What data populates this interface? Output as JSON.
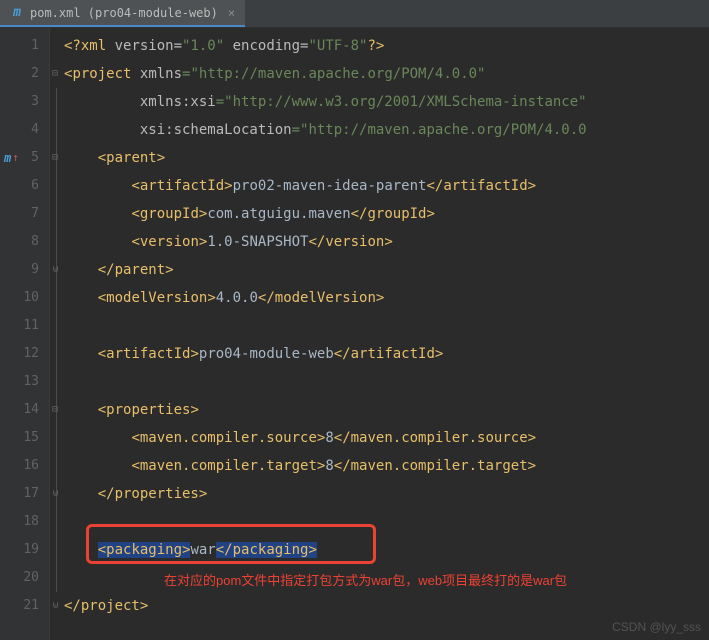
{
  "tab": {
    "icon": "m",
    "title": "pom.xml (pro04-module-web)",
    "close": "×"
  },
  "lines": {
    "count": 21,
    "markerLine": 5
  },
  "code": {
    "l1": {
      "pi_open": "<?",
      "pi_name": "xml",
      "attrs": " version=",
      "v1": "\"1.0\"",
      "attrs2": " encoding=",
      "v2": "\"UTF-8\"",
      "pi_close": "?>"
    },
    "l2": {
      "open": "<",
      "tag": "project",
      "sp": " ",
      "attr": "xmlns",
      "eq": "=",
      "val": "\"http://maven.apache.org/POM/4.0.0\""
    },
    "l3": {
      "attr": "xmlns:xsi",
      "eq": "=",
      "val": "\"http://www.w3.org/2001/XMLSchema-instance\""
    },
    "l4": {
      "attr": "xsi:schemaLocation",
      "eq": "=",
      "val": "\"http://maven.apache.org/POM/4.0.0 "
    },
    "l5": {
      "open": "<",
      "tag": "parent",
      "close": ">"
    },
    "l6": {
      "open": "<",
      "tag": "artifactId",
      "gt": ">",
      "txt": "pro02-maven-idea-parent",
      "ct": "</",
      "ctag": "artifactId",
      "cgt": ">"
    },
    "l7": {
      "open": "<",
      "tag": "groupId",
      "gt": ">",
      "txt": "com.atguigu.maven",
      "ct": "</",
      "ctag": "groupId",
      "cgt": ">"
    },
    "l8": {
      "open": "<",
      "tag": "version",
      "gt": ">",
      "txt": "1.0-SNAPSHOT",
      "ct": "</",
      "ctag": "version",
      "cgt": ">"
    },
    "l9": {
      "ct": "</",
      "tag": "parent",
      "gt": ">"
    },
    "l10": {
      "open": "<",
      "tag": "modelVersion",
      "gt": ">",
      "txt": "4.0.0",
      "ct": "</",
      "ctag": "modelVersion",
      "cgt": ">"
    },
    "l12": {
      "open": "<",
      "tag": "artifactId",
      "gt": ">",
      "txt": "pro04-module-web",
      "ct": "</",
      "ctag": "artifactId",
      "cgt": ">"
    },
    "l14": {
      "open": "<",
      "tag": "properties",
      "gt": ">"
    },
    "l15": {
      "open": "<",
      "tag": "maven.compiler.source",
      "gt": ">",
      "txt": "8",
      "ct": "</",
      "ctag": "maven.compiler.source",
      "cgt": ">"
    },
    "l16": {
      "open": "<",
      "tag": "maven.compiler.target",
      "gt": ">",
      "txt": "8",
      "ct": "</",
      "ctag": "maven.compiler.target",
      "cgt": ">"
    },
    "l17": {
      "ct": "</",
      "tag": "properties",
      "gt": ">"
    },
    "l19": {
      "open": "<",
      "tag": "packaging",
      "gt": ">",
      "txt": "war",
      "ct": "</",
      "ctag": "packaging",
      "cgt": ">"
    },
    "l21": {
      "ct": "</",
      "tag": "project",
      "gt": ">"
    }
  },
  "annotation": "在对应的pom文件中指定打包方式为war包，web项目最终打的是war包",
  "watermark": "CSDN @lyy_sss"
}
